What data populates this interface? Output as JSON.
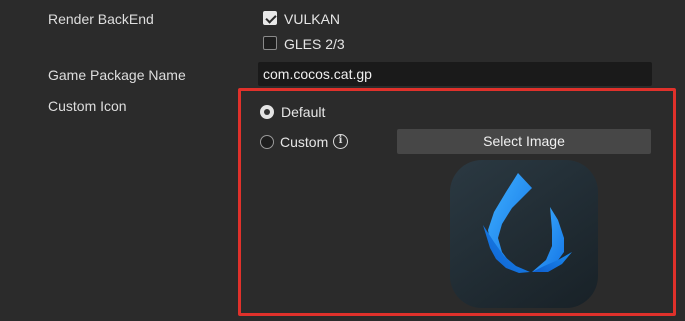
{
  "render_backend": {
    "label": "Render BackEnd",
    "options": [
      {
        "label": "VULKAN",
        "checked": true
      },
      {
        "label": "GLES 2/3",
        "checked": false
      }
    ]
  },
  "game_package": {
    "label": "Game Package Name",
    "value": "com.cocos.cat.gp"
  },
  "custom_icon": {
    "label": "Custom Icon",
    "default_label": "Default",
    "custom_label": "Custom",
    "selected": "Default",
    "select_button_label": "Select Image",
    "info_icon": "info-icon",
    "preview_icon": "cocos-flame-logo",
    "highlight_color": "#e0312b"
  }
}
